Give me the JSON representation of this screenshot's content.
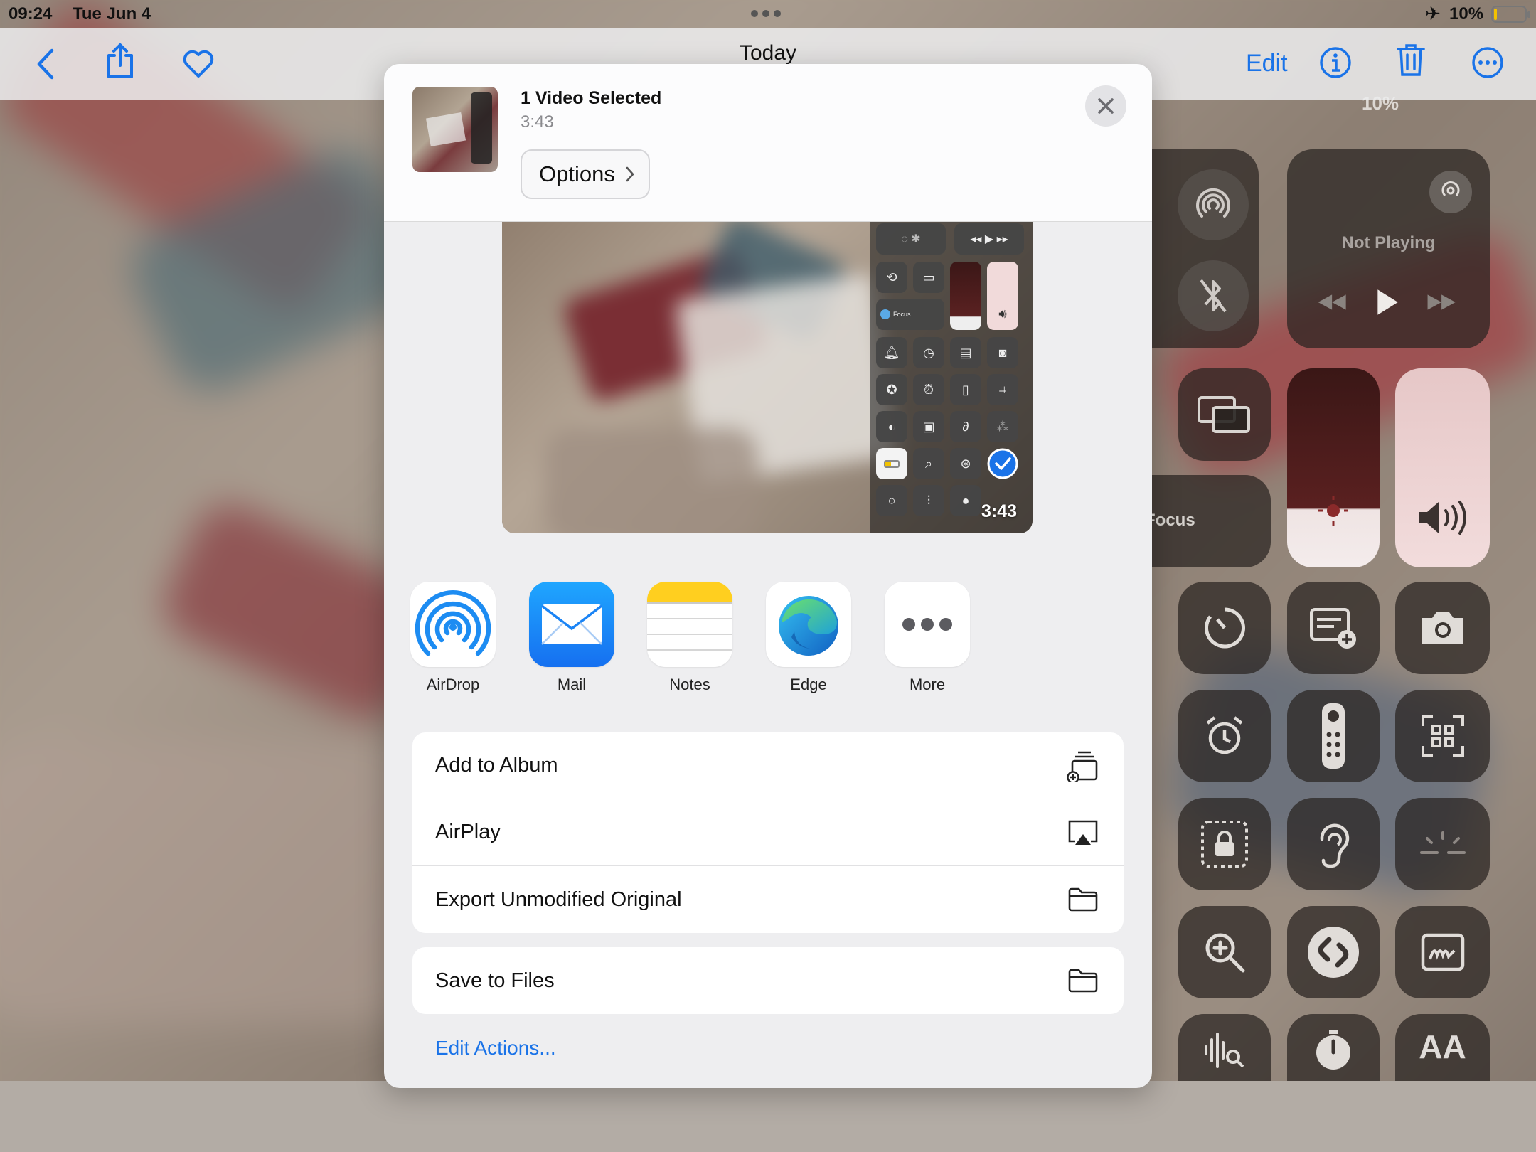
{
  "status_bar": {
    "time": "09:24",
    "date": "Tue Jun 4",
    "battery_percent": "10%",
    "battery_level": 0.1,
    "airplane_mode_icon": "airplane-icon"
  },
  "nav": {
    "title": "Today",
    "back_icon": "chevron-left-icon",
    "share_icon": "share-icon",
    "favorite_icon": "heart-icon",
    "edit_label": "Edit",
    "info_icon": "info-icon",
    "delete_icon": "trash-icon",
    "more_icon": "ellipsis-circle-icon",
    "accent_color": "#1a73e8"
  },
  "background_control_center": {
    "top_status_percent": "10%",
    "now_playing_label": "Not Playing",
    "focus_label": "Focus",
    "text_size_glyph": "AA"
  },
  "share_sheet": {
    "header": {
      "title": "1 Video Selected",
      "duration": "3:43",
      "options_label": "Options",
      "options_chevron": "chevron-right-icon",
      "close_icon": "close-icon"
    },
    "preview": {
      "duration": "3:43",
      "control_center_focus_label": "Focus"
    },
    "apps": [
      {
        "label": "AirDrop",
        "icon": "airdrop-icon"
      },
      {
        "label": "Mail",
        "icon": "mail-icon"
      },
      {
        "label": "Notes",
        "icon": "notes-icon"
      },
      {
        "label": "Edge",
        "icon": "edge-icon"
      },
      {
        "label": "More",
        "icon": "more-icon"
      }
    ],
    "actions": [
      {
        "label": "Add to Album",
        "icon": "add-to-album-icon"
      },
      {
        "label": "AirPlay",
        "icon": "airplay-icon"
      },
      {
        "label": "Export Unmodified Original",
        "icon": "folder-icon"
      }
    ],
    "secondary_actions": [
      {
        "label": "Save to Files",
        "icon": "folder-icon"
      }
    ],
    "edit_actions_label": "Edit Actions..."
  }
}
